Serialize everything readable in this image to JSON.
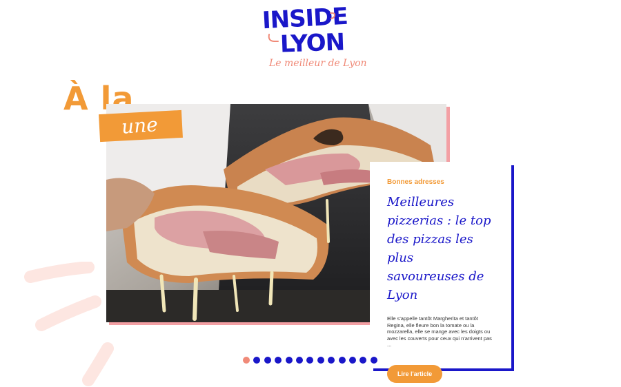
{
  "logo": {
    "line1": "INSIDE",
    "line2": "LYON",
    "tagline": "Le meilleur de Lyon"
  },
  "heading": {
    "part1": "À la",
    "part2": "une"
  },
  "featured": {
    "category": "Bonnes adresses",
    "title": "Meilleures pizzerias : le top des pizzas les plus savoureuses de Lyon",
    "excerpt": "Elle s'appelle tantôt Margherita et tantôt Regina, elle fleure bon la tomate ou la mozzarella, elle se mange avec les doigts ou avec les couverts pour ceux qui n'arrivent pas ...",
    "button_label": "Lire l'article"
  },
  "pagination": {
    "count": 13,
    "active_index": 0
  },
  "colors": {
    "brand_blue": "#1a17c9",
    "accent_orange": "#f29a37",
    "accent_pink": "#f08a78",
    "image_shadow": "#f3a0a4"
  }
}
